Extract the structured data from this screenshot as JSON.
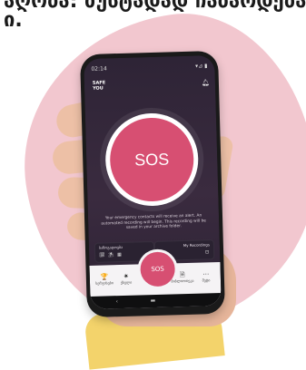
{
  "headline": {
    "line1": "ა⁠ღობა: ზუსტადად ჩაბარდება",
    "line2": "ი."
  },
  "phone": {
    "status": {
      "time": "02:14",
      "icons_left": "⚲ ▪ ⊕ ·",
      "icons_right": "▾⊿ ▮"
    },
    "logo": {
      "line1": "SAFE",
      "line2": "YOU"
    },
    "sos_label": "SOS",
    "info_text": "Your emergency contacts will receive an alert. An automated recording will begin. This recording will be saved in your archive folder.",
    "cards": [
      {
        "label": "საზოგადოება",
        "icons": "🗓 ⛱ ▦"
      },
      {
        "label": "My Recordings",
        "icons": "⊡"
      }
    ],
    "nav": [
      {
        "label": "სერვისები",
        "icon": "🏆"
      },
      {
        "label": "ქსელი",
        "icon": "✷"
      },
      {
        "label": "ბიბლიოთეკა",
        "icon": "🗎"
      },
      {
        "label": "მეტი",
        "icon": "⋯"
      }
    ],
    "fab_label": "SOS",
    "android": {
      "back": "‹",
      "home": "▬"
    }
  },
  "colors": {
    "accent": "#d74f72",
    "blob": "#f2c7cf",
    "screen": "#2e2436",
    "sleeve": "#f3d36b"
  }
}
